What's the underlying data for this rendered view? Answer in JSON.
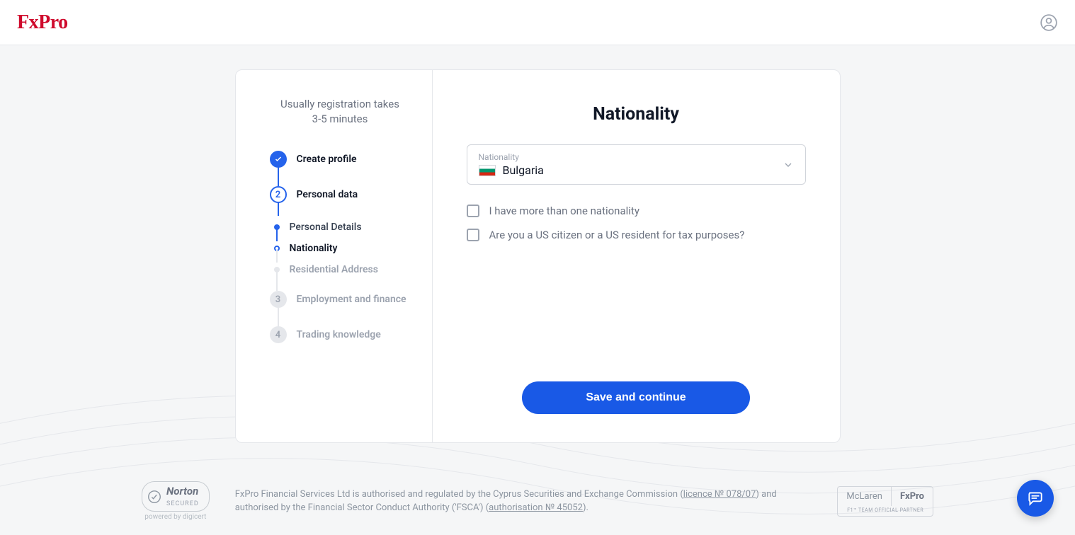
{
  "brand": "FxPro",
  "sidebar": {
    "intro_line1": "Usually registration takes",
    "intro_line2": "3-5 minutes",
    "steps": {
      "s1": {
        "label": "Create profile"
      },
      "s2": {
        "label": "Personal data",
        "num": "2"
      },
      "s2a": {
        "label": "Personal Details"
      },
      "s2b": {
        "label": "Nationality"
      },
      "s2c": {
        "label": "Residential Address"
      },
      "s3": {
        "label": "Employment and finance",
        "num": "3"
      },
      "s4": {
        "label": "Trading knowledge",
        "num": "4"
      }
    }
  },
  "main": {
    "title": "Nationality",
    "select_label": "Nationality",
    "select_value": "Bulgaria",
    "check1": "I have more than one nationality",
    "check2": "Are you a US citizen or a US resident for tax purposes?",
    "button": "Save and continue"
  },
  "footer": {
    "norton_title": "Norton",
    "norton_sub": "SECURED",
    "norton_by": "powered by digicert",
    "legal_pre": "FxPro Financial Services Ltd is authorised and regulated by the Cyprus Securities and Exchange Commission (",
    "legal_link1": "licence № 078/07",
    "legal_mid": ") and authorised by the Financial Sector Conduct Authority ('FSCA') (",
    "legal_link2": "authorisation № 45052",
    "legal_post": ").",
    "partner1": "McLaren",
    "partner2": "FxPro",
    "partner_sub": "F1™ TEAM OFFICIAL PARTNER"
  }
}
